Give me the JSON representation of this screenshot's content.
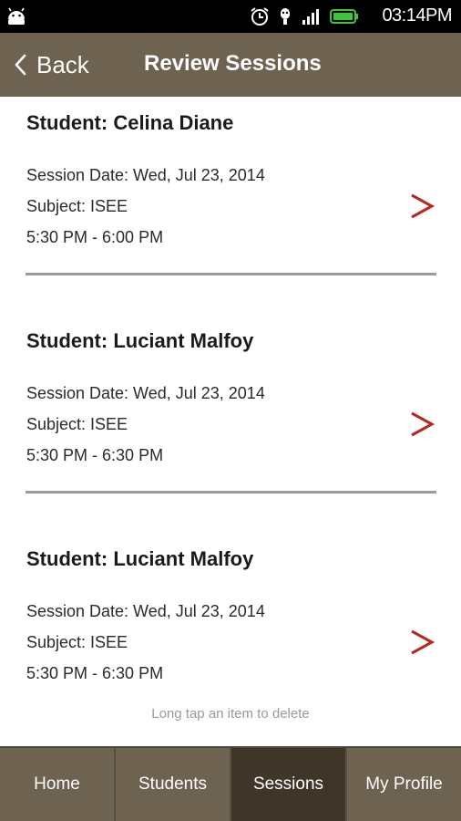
{
  "status_bar": {
    "time": "03:14PM",
    "icons": [
      "android-icon",
      "alarm-icon",
      "usb-icon",
      "signal-icon",
      "battery-icon"
    ]
  },
  "header": {
    "back_label": "Back",
    "title": "Review Sessions"
  },
  "sessions": [
    {
      "student": "Student: Celina Diane",
      "date": "Session Date: Wed, Jul 23, 2014",
      "subject": "Subject: ISEE",
      "time": "5:30 PM - 6:00 PM"
    },
    {
      "student": "Student: Luciant Malfoy",
      "date": "Session Date: Wed, Jul 23, 2014",
      "subject": "Subject: ISEE",
      "time": "5:30 PM - 6:30 PM"
    },
    {
      "student": "Student: Luciant Malfoy",
      "date": "Session Date: Wed, Jul 23, 2014",
      "subject": "Subject: ISEE",
      "time": "5:30 PM - 6:30 PM"
    }
  ],
  "hint": "Long tap an item to delete",
  "tabs": [
    {
      "label": "Home",
      "active": false
    },
    {
      "label": "Students",
      "active": false
    },
    {
      "label": "Sessions",
      "active": true
    },
    {
      "label": "My Profile",
      "active": false
    }
  ],
  "colors": {
    "bar": "#6e6250",
    "active_tab": "#3f3629",
    "chevron": "#b5281e"
  }
}
